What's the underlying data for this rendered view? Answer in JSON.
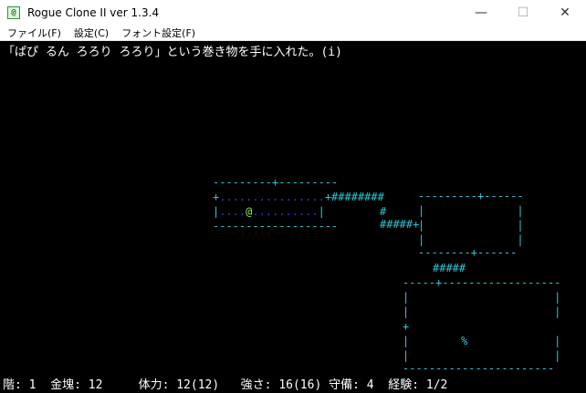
{
  "window": {
    "title": "Rogue Clone II ver 1.3.4",
    "icon": "rogue-app-icon",
    "controls": {
      "minimize": "—",
      "maximize": "☐",
      "close": "✕"
    }
  },
  "menu": {
    "file": "ファイル(F)",
    "settings": "設定(C)",
    "font_settings": "フォント設定(F)"
  },
  "message": "「ぱぴ るん ろろり ろろり」という巻き物を手に入れた。(i)",
  "map": {
    "room1_top": "---------+---------",
    "room1_row1_door": "+",
    "room1_row1_floor": "................",
    "room1_row1_exit": "+########",
    "room1_row2_wall": "|",
    "room1_row2_floorA": "....",
    "room1_hero": "@",
    "room1_row2_floorB": "..........",
    "room1_row2_wall_r": "|",
    "room1_bottom": "-------------------",
    "corridor_down": "#",
    "corridor_mid": "#####+",
    "room2_top": "---------+------",
    "room2_side": "|              |",
    "room2_bottom": "--------+------",
    "corridor_low": "#####",
    "room3_top": "-----+------------------",
    "room3_side": "|                      |",
    "room3_door": "+",
    "room3_item": "%",
    "room3_bottom": "-----------------------"
  },
  "status": {
    "line": "階: 1  金塊: 12     体力: 12(12)   強さ: 16(16) 守備: 4  経験: 1/2"
  },
  "colors": {
    "background": "#000000",
    "walls": "#2fc6d6",
    "floor": "#2c3bd6",
    "hero": "#8bf04a",
    "item": "#e4e45a",
    "text": "#ffffff"
  }
}
